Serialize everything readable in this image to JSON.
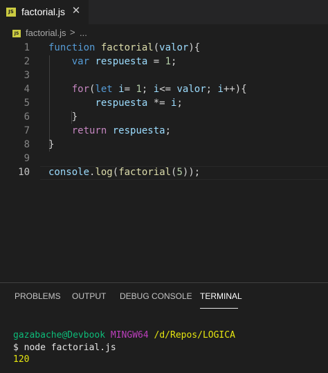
{
  "tabs": [
    {
      "badge": "JS",
      "label": "factorial.js",
      "close": "✕"
    }
  ],
  "breadcrumb": {
    "badge": "JS",
    "file": "factorial.js",
    "separator": ">",
    "more": "..."
  },
  "editor": {
    "line_numbers": [
      "1",
      "2",
      "3",
      "4",
      "5",
      "6",
      "7",
      "8",
      "9",
      "10"
    ],
    "active_line": "10",
    "lines": [
      [
        [
          "kwb",
          "function "
        ],
        [
          "fn",
          "factorial"
        ],
        [
          "pl",
          "("
        ],
        [
          "var",
          "valor"
        ],
        [
          "pl",
          "){"
        ]
      ],
      [
        [
          "pl",
          "    "
        ],
        [
          "kwb",
          "var "
        ],
        [
          "var",
          "respuesta"
        ],
        [
          "pl",
          " = "
        ],
        [
          "num",
          "1"
        ],
        [
          "pl",
          ";"
        ]
      ],
      [
        [
          "pl",
          ""
        ]
      ],
      [
        [
          "pl",
          "    "
        ],
        [
          "kw",
          "for"
        ],
        [
          "pl",
          "("
        ],
        [
          "kwb",
          "let "
        ],
        [
          "var",
          "i"
        ],
        [
          "pl",
          "= "
        ],
        [
          "num",
          "1"
        ],
        [
          "pl",
          "; "
        ],
        [
          "var",
          "i"
        ],
        [
          "pl",
          "<= "
        ],
        [
          "var",
          "valor"
        ],
        [
          "pl",
          "; "
        ],
        [
          "var",
          "i"
        ],
        [
          "pl",
          "++){"
        ]
      ],
      [
        [
          "pl",
          "        "
        ],
        [
          "var",
          "respuesta"
        ],
        [
          "pl",
          " *= "
        ],
        [
          "var",
          "i"
        ],
        [
          "pl",
          ";"
        ]
      ],
      [
        [
          "pl",
          "    }"
        ]
      ],
      [
        [
          "pl",
          "    "
        ],
        [
          "kw",
          "return "
        ],
        [
          "var",
          "respuesta"
        ],
        [
          "pl",
          ";"
        ]
      ],
      [
        [
          "pl",
          "}"
        ]
      ],
      [
        [
          "pl",
          ""
        ]
      ],
      [
        [
          "var",
          "console"
        ],
        [
          "pl",
          "."
        ],
        [
          "fn",
          "log"
        ],
        [
          "pl",
          "("
        ],
        [
          "fn",
          "factorial"
        ],
        [
          "pl",
          "("
        ],
        [
          "num",
          "5"
        ],
        [
          "pl",
          "));"
        ]
      ]
    ]
  },
  "panel": {
    "tabs": [
      "PROBLEMS",
      "OUTPUT",
      "DEBUG CONSOLE",
      "TERMINAL"
    ],
    "active_tab": "TERMINAL"
  },
  "terminal": {
    "prompt_user": "gazabache@Devbook",
    "prompt_shell": "MINGW64",
    "prompt_path": "/d/Repos/LOGICA",
    "command": "$ node factorial.js",
    "output": "120"
  },
  "colors": {
    "keyword_control": "#c586c0",
    "keyword": "#569cd6",
    "function": "#dcdcaa",
    "variable": "#9cdcfe",
    "number": "#b5cea8",
    "js_badge": "#cbcb41"
  }
}
